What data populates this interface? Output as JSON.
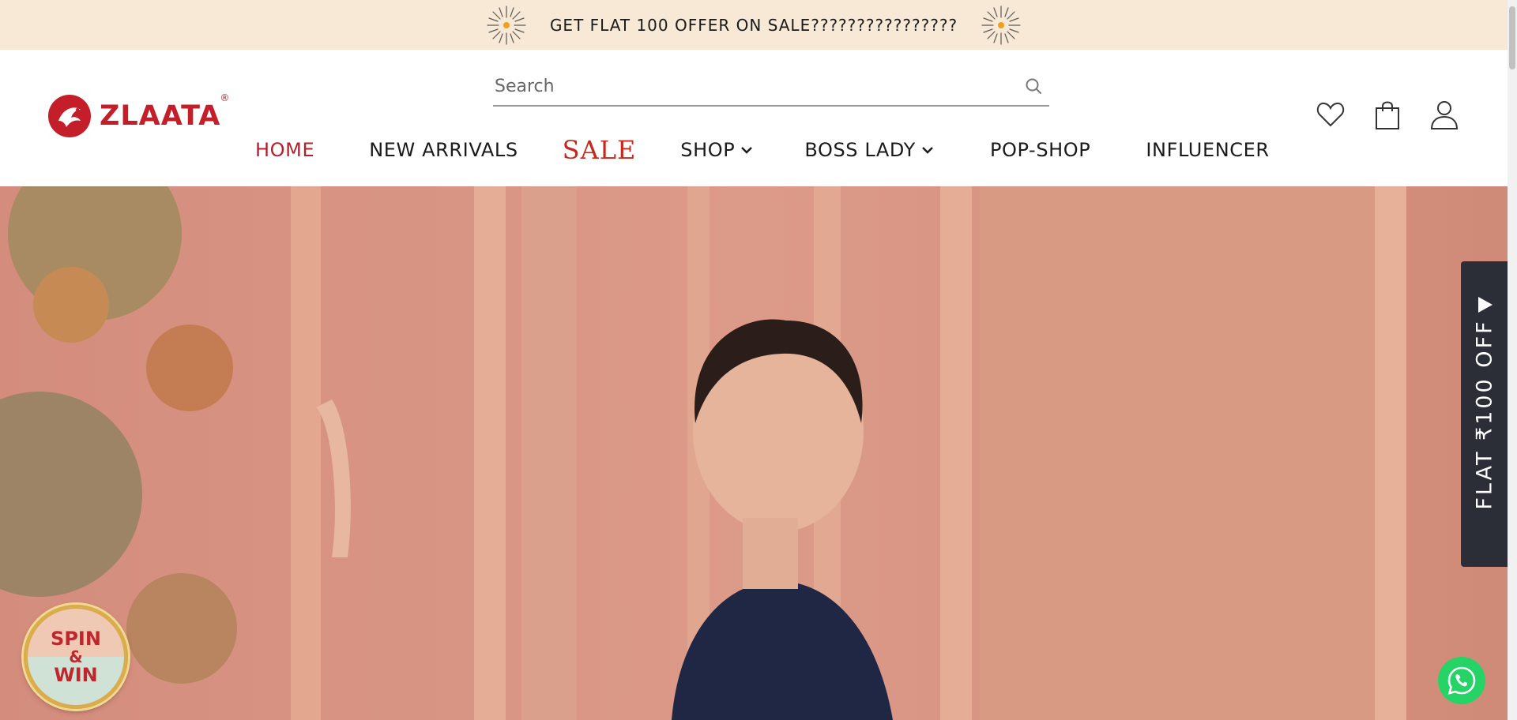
{
  "announcement": {
    "text": "GET FLAT 100 OFFER ON SALE????????????????"
  },
  "brand": {
    "name": "ZLAATA",
    "registered": "®",
    "accent": "#c41e2a"
  },
  "search": {
    "placeholder": "Search",
    "value": ""
  },
  "nav": {
    "items": [
      {
        "label": "HOME",
        "active": true
      },
      {
        "label": "NEW ARRIVALS"
      },
      {
        "label": "SALE"
      },
      {
        "label": "SHOP",
        "has_dropdown": true
      },
      {
        "label": "BOSS LADY",
        "has_dropdown": true
      },
      {
        "label": "POP-SHOP"
      },
      {
        "label": "INFLUENCER"
      }
    ]
  },
  "header_icons": [
    "heart-icon",
    "shopping-bag-icon",
    "user-icon"
  ],
  "offer_tab": {
    "text": "FLAT ₹100 OFF"
  },
  "spin": {
    "line1": "SPIN",
    "line2": "&",
    "line3": "WIN"
  },
  "colors": {
    "announcement_bg": "#f8e8d6",
    "nav_active": "#b5202a",
    "sale": "#c7281e",
    "offer_bg": "#2b2e37",
    "whatsapp": "#25d366"
  }
}
